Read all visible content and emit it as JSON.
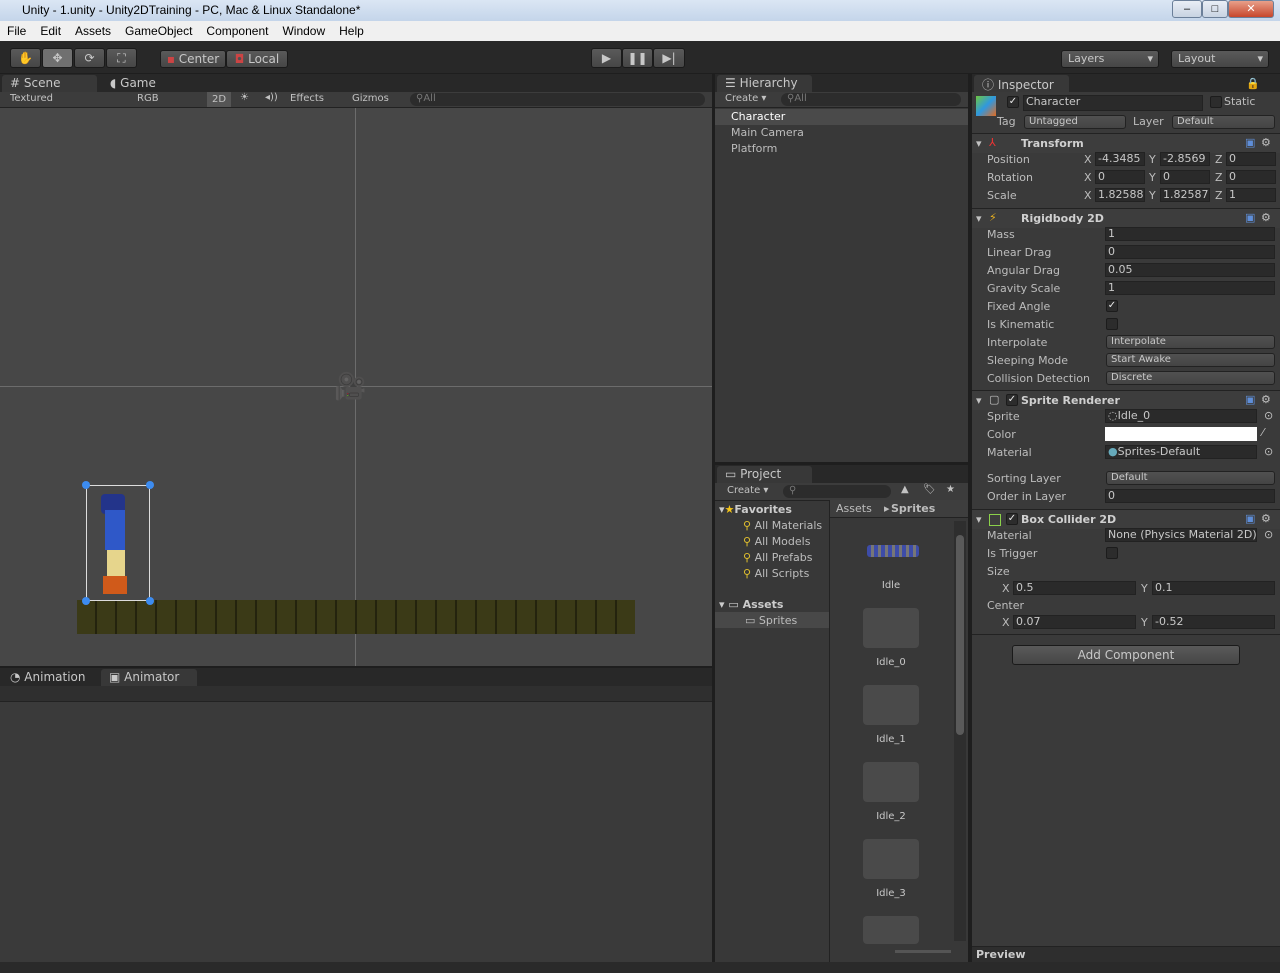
{
  "window": {
    "title": "Unity - 1.unity - Unity2DTraining - PC, Mac & Linux Standalone*"
  },
  "menu": [
    "File",
    "Edit",
    "Assets",
    "GameObject",
    "Component",
    "Window",
    "Help"
  ],
  "toolbar": {
    "pivot": "Center",
    "space": "Local",
    "layers": "Layers",
    "layout": "Layout"
  },
  "scene": {
    "tabs": [
      "Scene",
      "Game"
    ],
    "render_mode": "Textured",
    "channel": "RGB",
    "mode_2d": "2D",
    "effects": "Effects",
    "gizmos": "Gizmos",
    "search_placeholder": "All"
  },
  "animator": {
    "tabs": [
      "Animation",
      "Animator"
    ]
  },
  "hierarchy": {
    "tab": "Hierarchy",
    "create": "Create",
    "search_placeholder": "All",
    "items": [
      "Character",
      "Main Camera",
      "Platform"
    ],
    "selected": "Character"
  },
  "project": {
    "tab": "Project",
    "create": "Create",
    "favorites": "Favorites",
    "favorite_items": [
      "All Materials",
      "All Models",
      "All Prefabs",
      "All Scripts"
    ],
    "assets": "Assets",
    "folders": [
      "Sprites"
    ],
    "breadcrumb": [
      "Assets",
      "Sprites"
    ],
    "files": [
      "Idle",
      "Idle_0",
      "Idle_1",
      "Idle_2",
      "Idle_3"
    ]
  },
  "inspector": {
    "tab": "Inspector",
    "object_name": "Character",
    "active": true,
    "static_label": "Static",
    "static": false,
    "tag_label": "Tag",
    "tag": "Untagged",
    "layer_label": "Layer",
    "layer": "Default",
    "transform": {
      "title": "Transform",
      "position_label": "Position",
      "rotation_label": "Rotation",
      "scale_label": "Scale",
      "position": {
        "x": "-4.3485",
        "y": "-2.8569",
        "z": "0"
      },
      "rotation": {
        "x": "0",
        "y": "0",
        "z": "0"
      },
      "scale": {
        "x": "1.82588",
        "y": "1.82587",
        "z": "1"
      }
    },
    "rigidbody": {
      "title": "Rigidbody 2D",
      "rows": [
        {
          "label": "Mass",
          "value": "1"
        },
        {
          "label": "Linear Drag",
          "value": "0"
        },
        {
          "label": "Angular Drag",
          "value": "0.05"
        },
        {
          "label": "Gravity Scale",
          "value": "1"
        }
      ],
      "fixed_angle_label": "Fixed Angle",
      "fixed_angle": true,
      "kinematic_label": "Is Kinematic",
      "kinematic": false,
      "interpolate_label": "Interpolate",
      "interpolate": "Interpolate",
      "sleeping_label": "Sleeping Mode",
      "sleeping": "Start Awake",
      "collision_label": "Collision Detection",
      "collision": "Discrete"
    },
    "sprite_renderer": {
      "title": "Sprite Renderer",
      "sprite_label": "Sprite",
      "sprite": "Idle_0",
      "color_label": "Color",
      "color": "#ffffff",
      "material_label": "Material",
      "material": "Sprites-Default",
      "sorting_label": "Sorting Layer",
      "sorting": "Default",
      "order_label": "Order in Layer",
      "order": "0"
    },
    "box_collider": {
      "title": "Box Collider 2D",
      "material_label": "Material",
      "material": "None (Physics Material 2D)",
      "trigger_label": "Is Trigger",
      "trigger": false,
      "size_label": "Size",
      "size": {
        "x": "0.5",
        "y": "0.1"
      },
      "center_label": "Center",
      "center": {
        "x": "0.07",
        "y": "-0.52"
      }
    },
    "add_component": "Add Component",
    "preview": "Preview"
  },
  "axis": {
    "x": "X",
    "y": "Y",
    "z": "Z"
  }
}
